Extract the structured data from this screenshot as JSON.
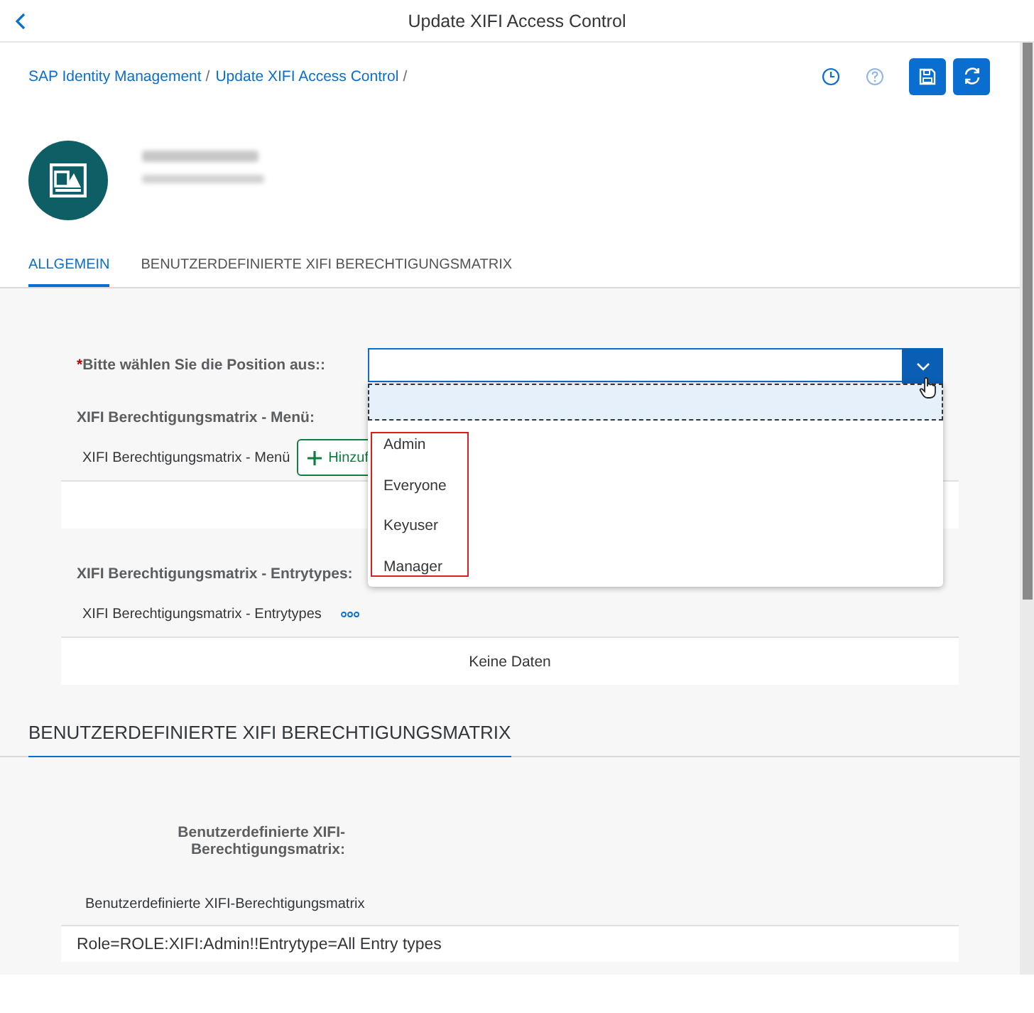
{
  "header": {
    "title": "Update XIFI Access Control"
  },
  "breadcrumbs": {
    "separator": "/",
    "items": [
      {
        "label": "SAP Identity Management"
      },
      {
        "label": "Update XIFI Access Control"
      }
    ]
  },
  "tabs": [
    {
      "label": "ALLGEMEIN",
      "selected": true
    },
    {
      "label": "BENUTZERDEFINIERTE XIFI BERECHTIGUNGSMATRIX",
      "selected": false
    }
  ],
  "position_field": {
    "label": "Bitte wählen Sie die Position aus::",
    "required": true,
    "required_mark": "*",
    "expanded": true
  },
  "dropdown": {
    "options": [
      {
        "label": "Admin"
      },
      {
        "label": "Everyone"
      },
      {
        "label": "Keyuser"
      },
      {
        "label": "Manager"
      }
    ]
  },
  "menu_section": {
    "title": "XIFI Berechtigungsmatrix - Menü:",
    "row_label": "XIFI Berechtigungsmatrix - Menü",
    "add_button": "Hinzuf"
  },
  "entrytypes_section": {
    "title": "XIFI Berechtigungsmatrix - Entrytypes:",
    "row_label": "XIFI Berechtigungsmatrix - Entrytypes",
    "empty_text": "Keine Daten"
  },
  "custom_section": {
    "heading": "BENUTZERDEFINIERTE XIFI BERECHTIGUNGSMATRIX",
    "field_label": "Benutzerdefinierte XIFI-Berechtigungsmatrix:",
    "row_label": "Benutzerdefinierte XIFI-Berechtigungsmatrix",
    "rows": [
      "Role=ROLE:XIFI:Admin!!Entrytype=All Entry types"
    ]
  }
}
